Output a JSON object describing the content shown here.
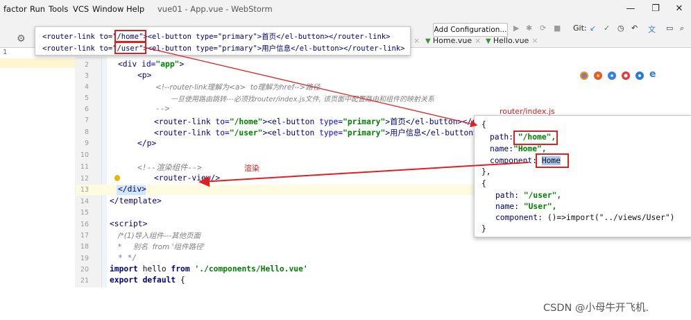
{
  "menu": [
    "factor",
    "Run",
    "Tools",
    "VCS",
    "Window",
    "Help"
  ],
  "window_title": "vue01 - App.vue - WebStorm",
  "window_controls": [
    "—",
    "❐",
    "✕"
  ],
  "toolbar": {
    "add_config": "Add Configuration...",
    "git_label": "Git:"
  },
  "tabs": [
    {
      "label": "Home.vue"
    },
    {
      "label": "Hello.vue"
    }
  ],
  "left_panel": {
    "number": "1"
  },
  "popup_top": {
    "line1": {
      "a": "<router-link to=\"",
      "path": "/home",
      "b": "\"><el-button type=\"primary\">首页</el-button></router-link>"
    },
    "line2": {
      "a": "<router-link to=\"",
      "path": "/user",
      "b": "\"><el-button type=\"primary\">用户信息</el-button></router-link>"
    }
  },
  "code": {
    "lines": [
      {
        "n": "2",
        "indent": 0,
        "html": "div_app"
      },
      {
        "n": "3"
      },
      {
        "n": "4"
      },
      {
        "n": "5"
      },
      {
        "n": "6"
      },
      {
        "n": "7"
      },
      {
        "n": "8"
      },
      {
        "n": "9"
      },
      {
        "n": "10"
      },
      {
        "n": "11"
      },
      {
        "n": "12"
      },
      {
        "n": "13"
      },
      {
        "n": "14"
      },
      {
        "n": "15"
      },
      {
        "n": "16"
      },
      {
        "n": "17"
      },
      {
        "n": "18"
      },
      {
        "n": "19"
      },
      {
        "n": "20"
      },
      {
        "n": "21"
      }
    ],
    "l2": {
      "open": "<div ",
      "attr": "id=",
      "val": "\"app\"",
      "close": ">"
    },
    "l3": "<p>",
    "l4": "<!--router-link理解为<a>  to理解为href-->路径",
    "l5": "一旦使用路由跳转---必须找router/index.js文件, 该页面中配置路由和组件的映射关系",
    "l6": "-->",
    "l7": {
      "a": "<router-link ",
      "to": "to=",
      "val": "\"/home\"",
      "b": "><el-button ",
      "type": "type=",
      "tval": "\"primary\"",
      "c": ">首页</el-button></router-"
    },
    "l8": {
      "a": "<router-link ",
      "to": "to=",
      "val": "\"/user\"",
      "b": "><el-button ",
      "type": "type=",
      "tval": "\"primary\"",
      "c": ">用户信息</el-button></ro"
    },
    "l9": "</p>",
    "l11": "<!--渲染组件-->",
    "l12": "<router-view/>",
    "l13": "</div>",
    "l14": "</template>",
    "l16": "<script>",
    "l17": "/*(1)导入组件---其他页面",
    "l18": "*     别名  from '组件路径'",
    "l19": "* */",
    "l20": {
      "kw": "import",
      "a": " hello ",
      "from": "from",
      "str": "'./components/Hello.vue'"
    },
    "l21": {
      "kw": "export default",
      "a": " {"
    }
  },
  "annotations": {
    "router_file": "router/index.js",
    "render": "渲染"
  },
  "popup_right": {
    "open": "{",
    "path_key": "path:",
    "path_val": "\"/home\",",
    "name_key": "name:",
    "name_val": "\"Home\",",
    "comp_key": "component:",
    "comp_val": "Home",
    "sep": "},",
    "open2": "{",
    "path2_key": "path:",
    "path2_val": "\"/user\",",
    "name2_key": "name:",
    "name2_val": "\"User\",",
    "comp2_key": "component:",
    "comp2_val": "()=>import(\"../views/User\")",
    "close": "}"
  },
  "watermark": "CSDN @小母牛开飞机.",
  "colors": {
    "red": "#e02020",
    "accent": "#3b7bd6"
  }
}
